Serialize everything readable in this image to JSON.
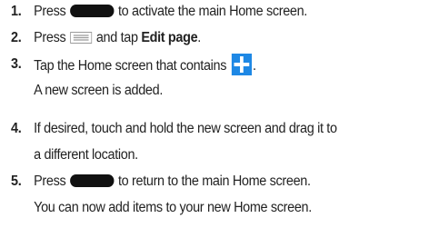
{
  "steps": [
    {
      "number": "1.",
      "before": "Press",
      "icon": "home-key-icon",
      "after": "to activate the main Home screen."
    },
    {
      "number": "2.",
      "before": "Press",
      "icon": "menu-key-icon",
      "middle": "and tap",
      "bold": "Edit page",
      "after": "."
    },
    {
      "number": "3.",
      "before": "Tap the Home screen that contains",
      "icon": "add-screen-icon",
      "after": ".",
      "sub": "A new screen is added."
    },
    {
      "number": "4.",
      "line1": "If desired, touch and hold the new screen and drag it to",
      "line2": "a different location."
    },
    {
      "number": "5.",
      "before": "Press",
      "icon": "home-key-icon",
      "after": "to return to the main Home screen.",
      "sub": "You can now add items to your new Home screen."
    }
  ],
  "colors": {
    "text": "#222222",
    "home_key": "#111111",
    "menu_key": "#9a9a9a",
    "add_icon_bg": "#1e88e5",
    "add_icon_plus": "#ffffff"
  }
}
